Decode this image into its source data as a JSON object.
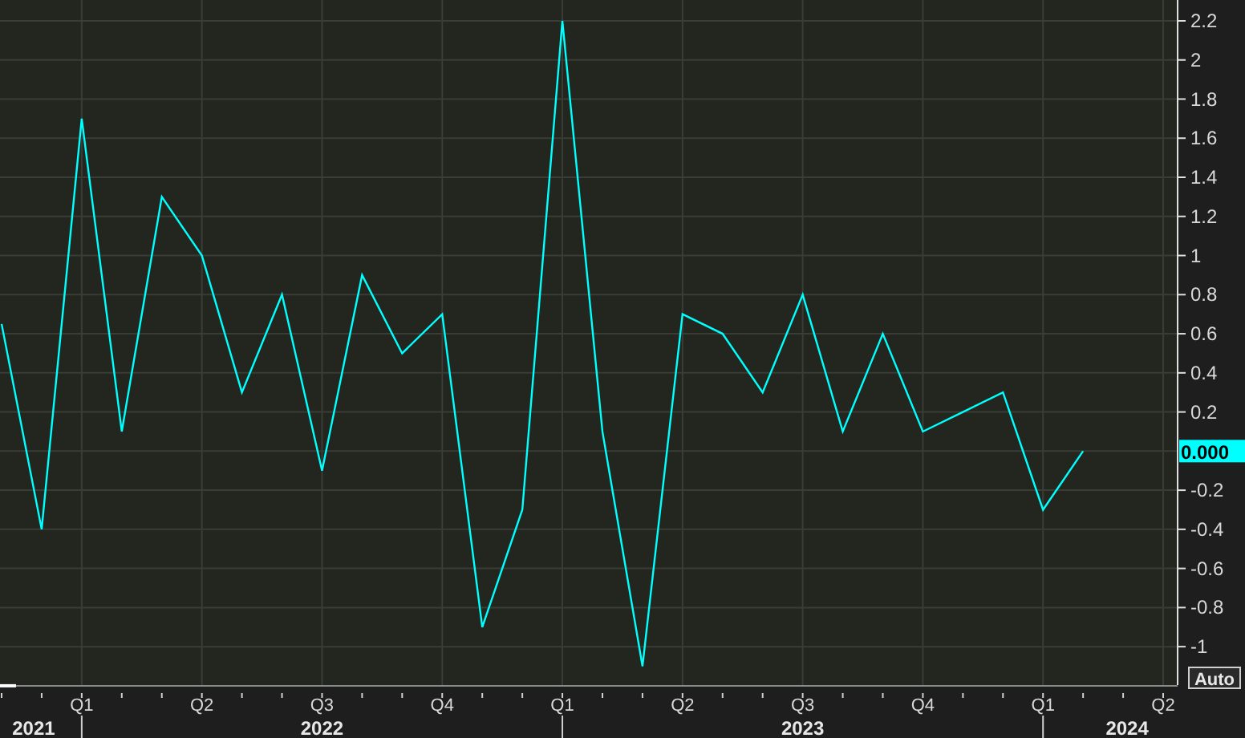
{
  "chart": {
    "chart_data": {
      "type": "line",
      "categories": [
        null,
        null,
        "Q1",
        null,
        null,
        "Q2",
        null,
        null,
        "Q3",
        null,
        null,
        "Q4",
        null,
        null,
        "Q1",
        null,
        null,
        "Q2",
        null,
        null,
        "Q3",
        null,
        null,
        "Q4",
        null,
        null,
        "Q1",
        null,
        null,
        "Q2"
      ],
      "series": [
        {
          "color": "#00ffff",
          "values": [
            0.65,
            -0.4,
            1.7,
            0.1,
            1.3,
            1.0,
            0.3,
            0.8,
            -0.1,
            0.9,
            0.5,
            0.7,
            -0.9,
            -0.3,
            2.2,
            0.1,
            -1.1,
            0.7,
            0.6,
            0.3,
            0.8,
            0.1,
            0.6,
            0.1,
            0.2,
            0.3,
            -0.3,
            0.0,
            null,
            null
          ]
        }
      ],
      "ylim": [
        -1.2,
        2.3
      ],
      "grid": true,
      "yticks": [
        {
          "value": 2.2,
          "label": "2.2"
        },
        {
          "value": 2,
          "label": "2"
        },
        {
          "value": 1.8,
          "label": "1.8"
        },
        {
          "value": 1.6,
          "label": "1.6"
        },
        {
          "value": 1.4,
          "label": "1.4"
        },
        {
          "value": 1.2,
          "label": "1.2"
        },
        {
          "value": 1,
          "label": "1"
        },
        {
          "value": 0.8,
          "label": "0.8"
        },
        {
          "value": 0.6,
          "label": "0.6"
        },
        {
          "value": 0.4,
          "label": "0.4"
        },
        {
          "value": 0.2,
          "label": "0.2"
        },
        {
          "value": -0.2,
          "label": "-0.2"
        },
        {
          "value": -0.4,
          "label": "-0.4"
        },
        {
          "value": -0.6,
          "label": "-0.6"
        },
        {
          "value": -0.8,
          "label": "-0.8"
        },
        {
          "value": -1,
          "label": "-1"
        }
      ]
    },
    "last_value_label": "0.000",
    "year_labels": [
      "2021",
      "2022",
      "2023",
      "2024"
    ],
    "auto_button": "Auto"
  }
}
